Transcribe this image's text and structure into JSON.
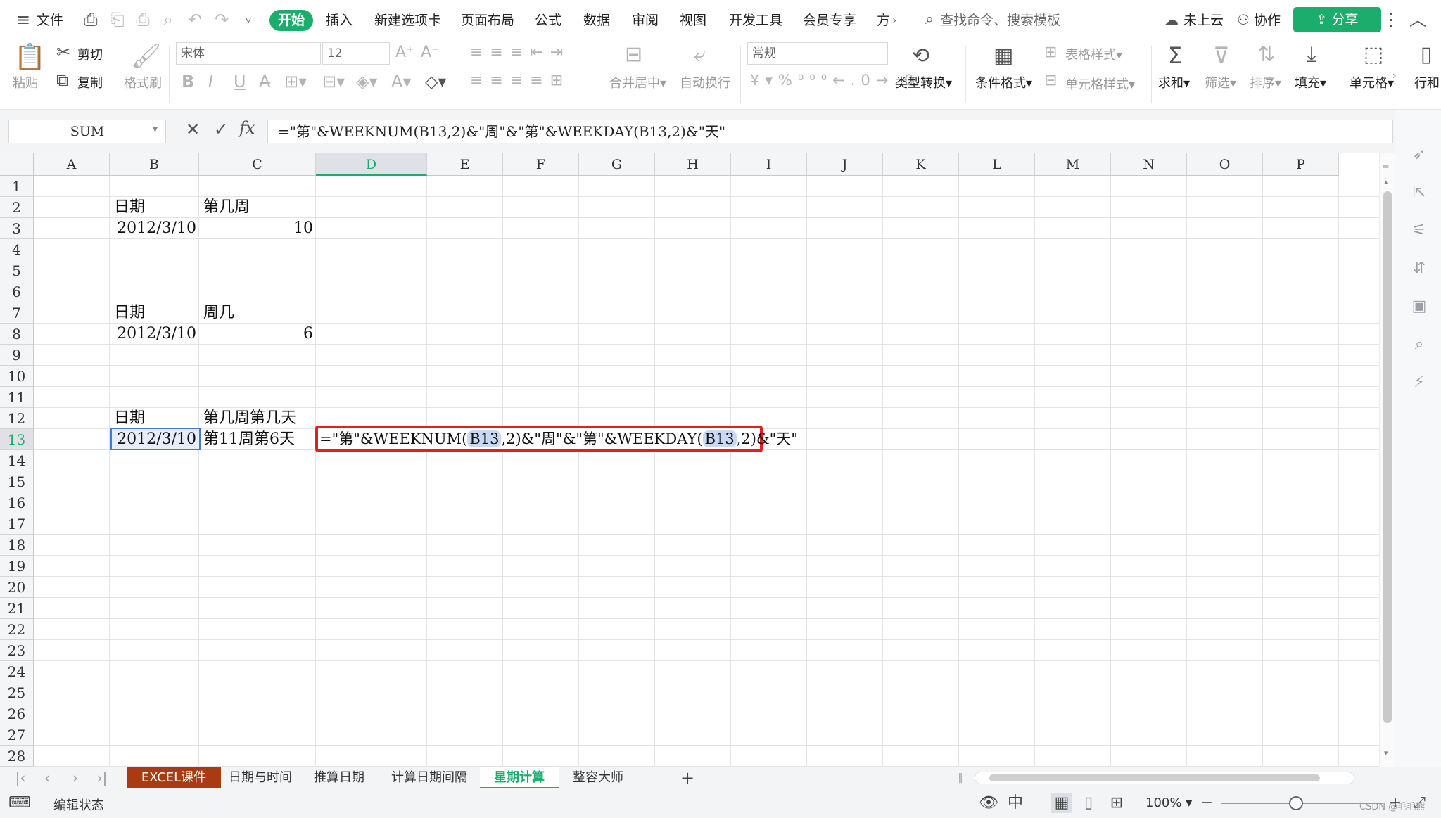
{
  "menu": {
    "file_label": "文件",
    "tabs": [
      "开始",
      "插入",
      "新建选项卡",
      "页面布局",
      "公式",
      "数据",
      "审阅",
      "视图",
      "开发工具",
      "会员专享",
      "方"
    ],
    "search_placeholder": "查找命令、搜索模板",
    "cloud_label": "未上云",
    "collab_label": "协作",
    "share_label": "分享"
  },
  "ribbon": {
    "paste": "粘贴",
    "cut": "剪切",
    "copy": "复制",
    "format_painter": "格式刷",
    "font_name": "宋体",
    "font_size": "12",
    "merge_center": "合并居中",
    "wrap_text": "自动换行",
    "number_format": "常规",
    "type_convert": "类型转换",
    "cond_format": "条件格式",
    "table_style": "表格样式",
    "cell_style": "单元格样式",
    "sum": "求和",
    "filter": "筛选",
    "sort": "排序",
    "fill": "填充",
    "cell": "单元格",
    "row_col": "行和"
  },
  "formula_bar": {
    "name_box": "SUM",
    "formula": "=\"第\"&WEEKNUM(B13,2)&\"周\"&\"第\"&WEEKDAY(B13,2)&\"天\""
  },
  "grid": {
    "columns": [
      "A",
      "B",
      "C",
      "D",
      "E",
      "F",
      "G",
      "H",
      "I",
      "J",
      "K",
      "L",
      "M",
      "N",
      "O",
      "P"
    ],
    "selected_column": "D",
    "selected_row": "13",
    "rows": [
      "1",
      "2",
      "3",
      "4",
      "5",
      "6",
      "7",
      "8",
      "9",
      "10",
      "11",
      "12",
      "13",
      "14",
      "15",
      "16",
      "17",
      "18",
      "19",
      "20",
      "21",
      "22",
      "23",
      "24",
      "25",
      "26",
      "27",
      "28"
    ],
    "cells": {
      "B2": "日期",
      "C2": "第几周",
      "B3": "2012/3/10",
      "C3": "10",
      "B7": "日期",
      "C7": "周几",
      "B8": "2012/3/10",
      "C8": "6",
      "B12": "日期",
      "C12": "第几周第几天",
      "B13": "2012/3/10",
      "C13": "第11周第6天"
    },
    "edit": {
      "p1": "=\"第\"&WEEKNUM(",
      "ref1": "B13",
      "p2": ",2)&\"周\"&\"第\"&WEEKDAY(",
      "ref2": "B13",
      "p3": ",2)&\"天\""
    }
  },
  "sheets": [
    "EXCEL课件",
    "日期与时间",
    "推算日期",
    "计算日期间隔",
    "星期计算",
    "整容大师"
  ],
  "active_sheet": "星期计算",
  "status": {
    "mode": "编辑状态",
    "zoom": "100%",
    "watermark": "CSDN @毛毛熊"
  }
}
